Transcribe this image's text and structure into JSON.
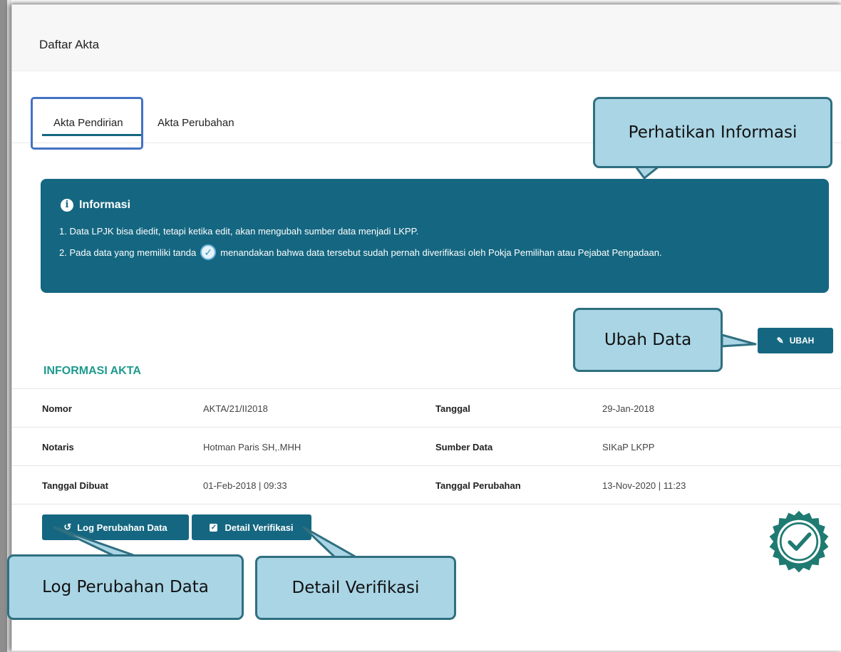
{
  "page_title": "Daftar Akta",
  "tabs": [
    {
      "label": "Akta Pendirian",
      "active": true
    },
    {
      "label": "Akta Perubahan",
      "active": false
    }
  ],
  "info": {
    "title": "Informasi",
    "line1": "1. Data LPJK bisa diedit, tetapi ketika edit, akan mengubah sumber data menjadi LKPP.",
    "line2_before": "2. Pada data yang memiliki tanda",
    "line2_after": "menandakan bahwa data tersebut sudah pernah diverifikasi oleh Pokja Pemilihan atau Pejabat Pengadaan."
  },
  "ubah_button": "UBAH",
  "section_title": "INFORMASI AKTA",
  "table": {
    "rows": [
      {
        "l1": "Nomor",
        "v1": "AKTA/21/II2018",
        "l2": "Tanggal",
        "v2": "29-Jan-2018"
      },
      {
        "l1": "Notaris",
        "v1": "Hotman Paris SH,.MHH",
        "l2": "Sumber Data",
        "v2": "SIKaP LKPP"
      },
      {
        "l1": "Tanggal Dibuat",
        "v1": "01-Feb-2018 | 09:33",
        "l2": "Tanggal Perubahan",
        "v2": "13-Nov-2020 | 11:23"
      }
    ]
  },
  "buttons": {
    "log": "Log Perubahan Data",
    "detail": "Detail Verifikasi"
  },
  "callouts": {
    "perhatikan": "Perhatikan Informasi",
    "ubah": "Ubah Data",
    "log": "Log Perubahan Data",
    "detail": "Detail Verifikasi"
  },
  "colors": {
    "primary": "#156781",
    "accent_title": "#1e9a8e",
    "callout_fill": "#a9d5e5",
    "callout_border": "#2f6f80",
    "tab_highlight": "#4472c4"
  },
  "icons": {
    "info": "info-circle-icon",
    "verified_check": "check-circle-icon",
    "edit": "edit-icon",
    "history": "history-icon",
    "check_square": "check-square-icon",
    "verified_badge": "verified-badge-icon"
  }
}
